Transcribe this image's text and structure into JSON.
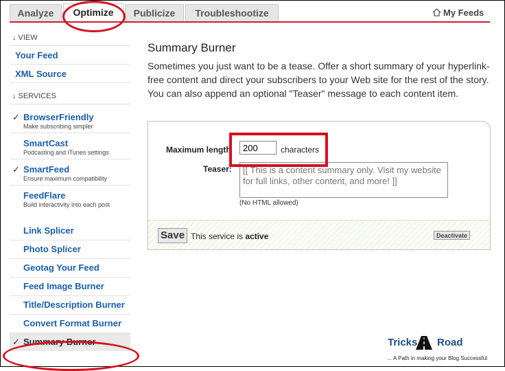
{
  "tabs": [
    {
      "label": "Analyze",
      "active": false
    },
    {
      "label": "Optimize",
      "active": true
    },
    {
      "label": "Publicize",
      "active": false
    },
    {
      "label": "Troubleshootize",
      "active": false
    }
  ],
  "my_feeds": {
    "label": "My Feeds",
    "icon": "house-icon"
  },
  "sidebar": {
    "view_heading": "VIEW",
    "view_items": [
      {
        "label": "Your Feed"
      },
      {
        "label": "XML Source"
      }
    ],
    "services_heading": "SERVICES",
    "service_items": [
      {
        "label": "BrowserFriendly",
        "sub": "Make subscribing simpler",
        "checked": true
      },
      {
        "label": "SmartCast",
        "sub": "Podcasting and iTunes settings",
        "checked": false
      },
      {
        "label": "SmartFeed",
        "sub": "Ensure maximum compatibility",
        "checked": true
      },
      {
        "label": "FeedFlare",
        "sub": "Build interactivity into each post",
        "checked": false
      }
    ],
    "other_items": [
      {
        "label": "Link Splicer"
      },
      {
        "label": "Photo Splicer"
      },
      {
        "label": "Geotag Your Feed"
      },
      {
        "label": "Feed Image Burner"
      },
      {
        "label": "Title/Description Burner"
      },
      {
        "label": "Convert Format Burner"
      }
    ],
    "current_item": {
      "label": "Summary Burner",
      "checked": true
    },
    "check_glyph": "✓",
    "arrow_glyph": "↓"
  },
  "main": {
    "title": "Summary Burner",
    "description": "Sometimes you just want to be a tease. Offer a short summary of your hyperlink-free content and direct your subscribers to your Web site for the rest of the story. You can also append an optional \"Teaser\" message to each content item.",
    "form": {
      "max_length_label": "Maximum length",
      "max_length_value": "200",
      "characters_label": "characters",
      "teaser_label": "Teaser:",
      "teaser_placeholder": "[[ This is a content summary only. Visit my website for full links, other content, and more! ]]",
      "no_html_note": "(No HTML allowed)",
      "save_label": "Save",
      "status_prefix": "This service is ",
      "status_value": "active",
      "deactivate_label": "Deactivate"
    }
  },
  "watermark": {
    "brand_left": "Tricks",
    "brand_right": "Road",
    "tagline": "... A Path in making your Blog Successful"
  },
  "colors": {
    "accent_red": "#cc1f2f",
    "link_blue": "#1a5fa8",
    "annotation_red": "#d5101f"
  }
}
